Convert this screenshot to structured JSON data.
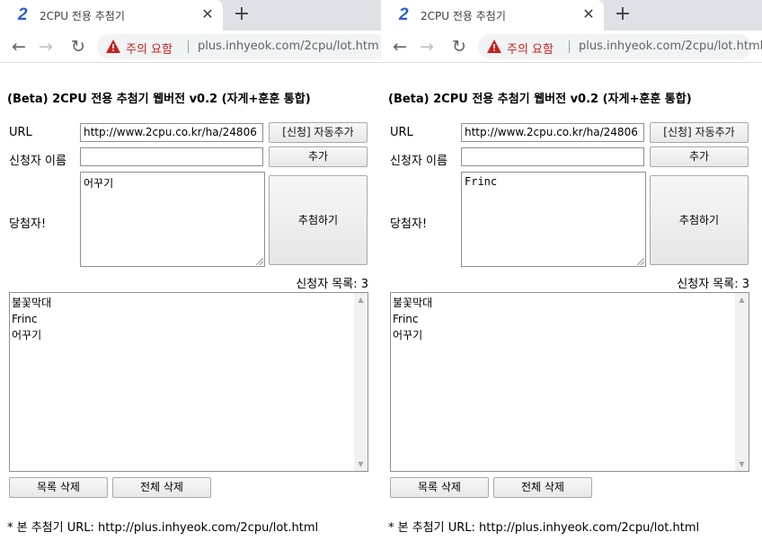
{
  "panes": [
    {
      "tab": {
        "logo": "2",
        "title": "2CPU 전용 추첨기"
      },
      "address": {
        "warning": "주의 요함",
        "url": "plus.inhyeok.com/2cpu/lot.htm"
      },
      "page": {
        "title": "(Beta) 2CPU 전용 추첨기 웹버전 v0.2 (자게+훈훈 통합)",
        "url_label": "URL",
        "url_value": "http://www.2cpu.co.kr/ha/24806",
        "auto_add_button": "[신청] 자동추가",
        "name_label": "신청자 이름",
        "name_value": "",
        "add_button": "추가",
        "winner_label": "당첨자!",
        "winner_value": "어꾸기",
        "draw_button": "추첨하기",
        "count_text": "신청자 목록: 3",
        "applicants": [
          "불꽃막대",
          "Frinc",
          "어꾸기"
        ],
        "delete_button": "목록 삭제",
        "delete_all_button": "전체 삭제",
        "footer": "* 본 추첨기 URL: http://plus.inhyeok.com/2cpu/lot.html"
      }
    },
    {
      "tab": {
        "logo": "2",
        "title": "2CPU 전용 추첨기"
      },
      "address": {
        "warning": "주의 요함",
        "url": "plus.inhyeok.com/2cpu/lot.html"
      },
      "page": {
        "title": "(Beta) 2CPU 전용 추첨기 웹버전 v0.2 (자게+훈훈 통합)",
        "url_label": "URL",
        "url_value": "http://www.2cpu.co.kr/ha/24806",
        "auto_add_button": "[신청] 자동추가",
        "name_label": "신청자 이름",
        "name_value": "",
        "add_button": "추가",
        "winner_label": "당첨자!",
        "winner_value": "Frinc",
        "draw_button": "추첨하기",
        "count_text": "신청자 목록: 3",
        "applicants": [
          "불꽃막대",
          "Frinc",
          "어꾸기"
        ],
        "delete_button": "목록 삭제",
        "delete_all_button": "전체 삭제",
        "footer": "* 본 추첨기 URL: http://plus.inhyeok.com/2cpu/lot.html"
      }
    }
  ],
  "icons": {
    "close": "close-icon",
    "new_tab": "plus-icon",
    "back": "arrow-left-icon",
    "forward": "arrow-right-icon",
    "reload": "reload-icon",
    "warning": "warning-triangle-icon"
  },
  "colors": {
    "tabstrip": "#dee1e6",
    "warning_text": "#c5221f",
    "logo": "#2d5fd0"
  }
}
